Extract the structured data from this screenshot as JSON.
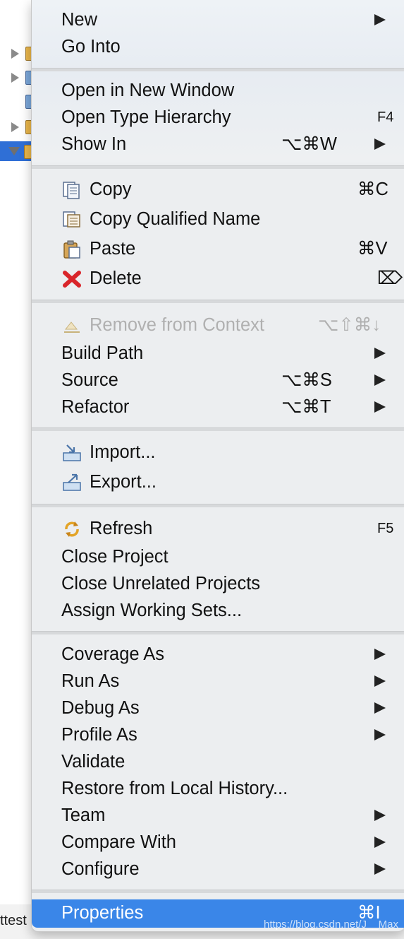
{
  "background": {
    "bottom_text": "ttest"
  },
  "menu": {
    "groups": [
      {
        "items": [
          {
            "label": "New",
            "submenu": true
          },
          {
            "label": "Go Into"
          }
        ]
      },
      {
        "items": [
          {
            "label": "Open in New Window"
          },
          {
            "label": "Open Type Hierarchy",
            "shortcut": "F4"
          },
          {
            "label": "Show In",
            "shortcut": "⌥⌘W",
            "submenu": true
          }
        ]
      },
      {
        "items": [
          {
            "label": "Copy",
            "shortcut": "⌘C",
            "icon": "copy-icon"
          },
          {
            "label": "Copy Qualified Name",
            "icon": "copy-qualified-name-icon"
          },
          {
            "label": "Paste",
            "shortcut": "⌘V",
            "icon": "paste-icon"
          },
          {
            "label": "Delete",
            "shortcut": "⌦",
            "icon": "delete-icon"
          }
        ]
      },
      {
        "items": [
          {
            "label": "Remove from Context",
            "shortcut": "⌥⇧⌘↓",
            "icon": "remove-context-icon",
            "disabled": true
          },
          {
            "label": "Build Path",
            "submenu": true
          },
          {
            "label": "Source",
            "shortcut": "⌥⌘S",
            "submenu": true
          },
          {
            "label": "Refactor",
            "shortcut": "⌥⌘T",
            "submenu": true
          }
        ]
      },
      {
        "items": [
          {
            "label": "Import...",
            "icon": "import-icon"
          },
          {
            "label": "Export...",
            "icon": "export-icon"
          }
        ]
      },
      {
        "items": [
          {
            "label": "Refresh",
            "shortcut": "F5",
            "icon": "refresh-icon"
          },
          {
            "label": "Close Project"
          },
          {
            "label": "Close Unrelated Projects"
          },
          {
            "label": "Assign Working Sets..."
          }
        ]
      },
      {
        "items": [
          {
            "label": "Coverage As",
            "submenu": true
          },
          {
            "label": "Run As",
            "submenu": true
          },
          {
            "label": "Debug As",
            "submenu": true
          },
          {
            "label": "Profile As",
            "submenu": true
          },
          {
            "label": "Validate"
          },
          {
            "label": "Restore from Local History..."
          },
          {
            "label": "Team",
            "submenu": true
          },
          {
            "label": "Compare With",
            "submenu": true
          },
          {
            "label": "Configure",
            "submenu": true
          }
        ]
      }
    ],
    "properties": {
      "label": "Properties",
      "shortcut": "⌘I"
    }
  },
  "watermark": "https://blog.csdn.net/J__Max",
  "colors": {
    "highlight": "#3a86e8",
    "menu_bg": "#eceef0",
    "disabled_text": "#b0b0b0",
    "tree_selection": "#2f6fd6"
  }
}
